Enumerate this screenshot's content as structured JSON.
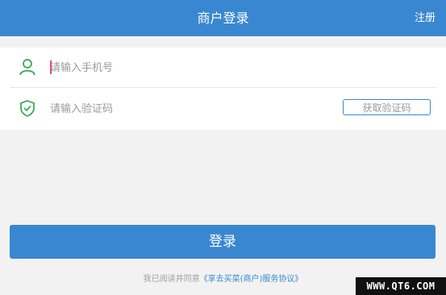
{
  "header": {
    "title": "商户登录",
    "action_label": "注册",
    "background": "#3a87d1"
  },
  "form": {
    "phone": {
      "icon": "user-icon",
      "placeholder": "请输入手机号",
      "value": ""
    },
    "code": {
      "icon": "shield-check-icon",
      "placeholder": "请输入验证码",
      "value": "",
      "get_code_label": "获取验证码"
    }
  },
  "login_button": {
    "label": "登录"
  },
  "agreement": {
    "prefix": "我已阅读并同意",
    "link": "《享去买菜(商户)服务协议》"
  },
  "watermark": {
    "text": "WWW.QT6.COM"
  },
  "colors": {
    "accent": "#3a87d1",
    "icon_green": "#3aa357",
    "caret": "#e0507a"
  }
}
